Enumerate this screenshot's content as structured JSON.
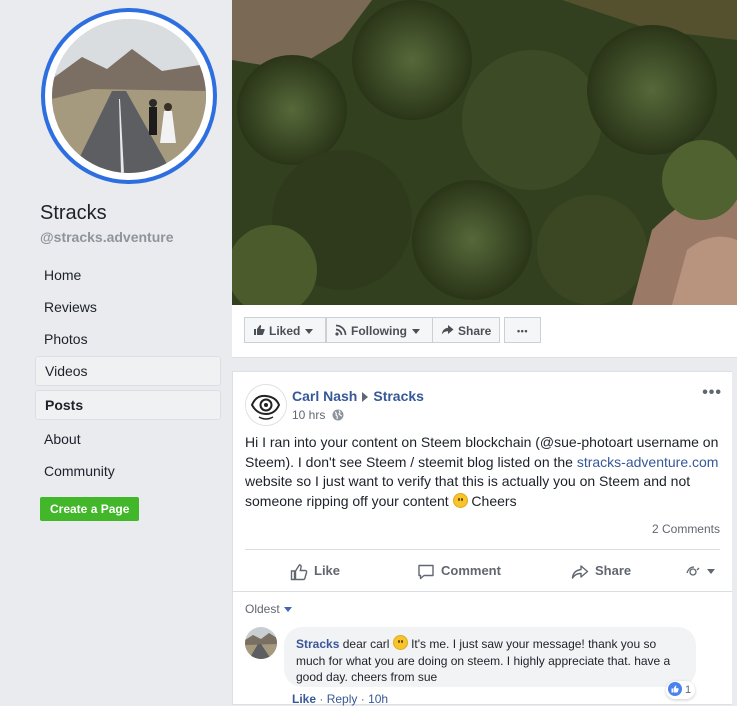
{
  "profile": {
    "name": "Stracks",
    "handle": "@stracks.adventure",
    "accent_color": "#2d6fe0"
  },
  "sidebar": {
    "items": [
      {
        "label": "Home"
      },
      {
        "label": "Reviews"
      },
      {
        "label": "Photos"
      },
      {
        "label": "Videos"
      },
      {
        "label": "Posts"
      },
      {
        "label": "About"
      },
      {
        "label": "Community"
      }
    ],
    "active_item": "Posts",
    "create_page_label": "Create a Page",
    "create_page_color": "#42b72a"
  },
  "action_bar": {
    "liked_label": "Liked",
    "following_label": "Following",
    "share_label": "Share",
    "more_label": "•••"
  },
  "post": {
    "author": "Carl Nash",
    "target": "Stracks",
    "time": "10 hrs",
    "menu_label": "•••",
    "text_before_link": "Hi I ran into your content on Steem blockchain (@sue-photoart username on Steem). I don't see Steem / steemit blog listed on the ",
    "link_text": "stracks-adventure.com",
    "text_after_link": " website so I just want to verify that this is actually you on Steem and not someone ripping off your content ",
    "text_end": " Cheers",
    "comment_count": "2 Comments",
    "actions": {
      "like": "Like",
      "comment": "Comment",
      "share": "Share"
    }
  },
  "comments": {
    "sort_label": "Oldest",
    "items": [
      {
        "author": "Stracks",
        "text_before_emoji": "dear carl ",
        "text_after_emoji": " It's me. I just saw your message! thank you so much for what you are doing on steem. I highly appreciate that. have a good day. cheers from sue",
        "reaction_count": "1",
        "like_label": "Like",
        "reply_label": "Reply",
        "separator": "·",
        "time": "10h"
      }
    ]
  }
}
